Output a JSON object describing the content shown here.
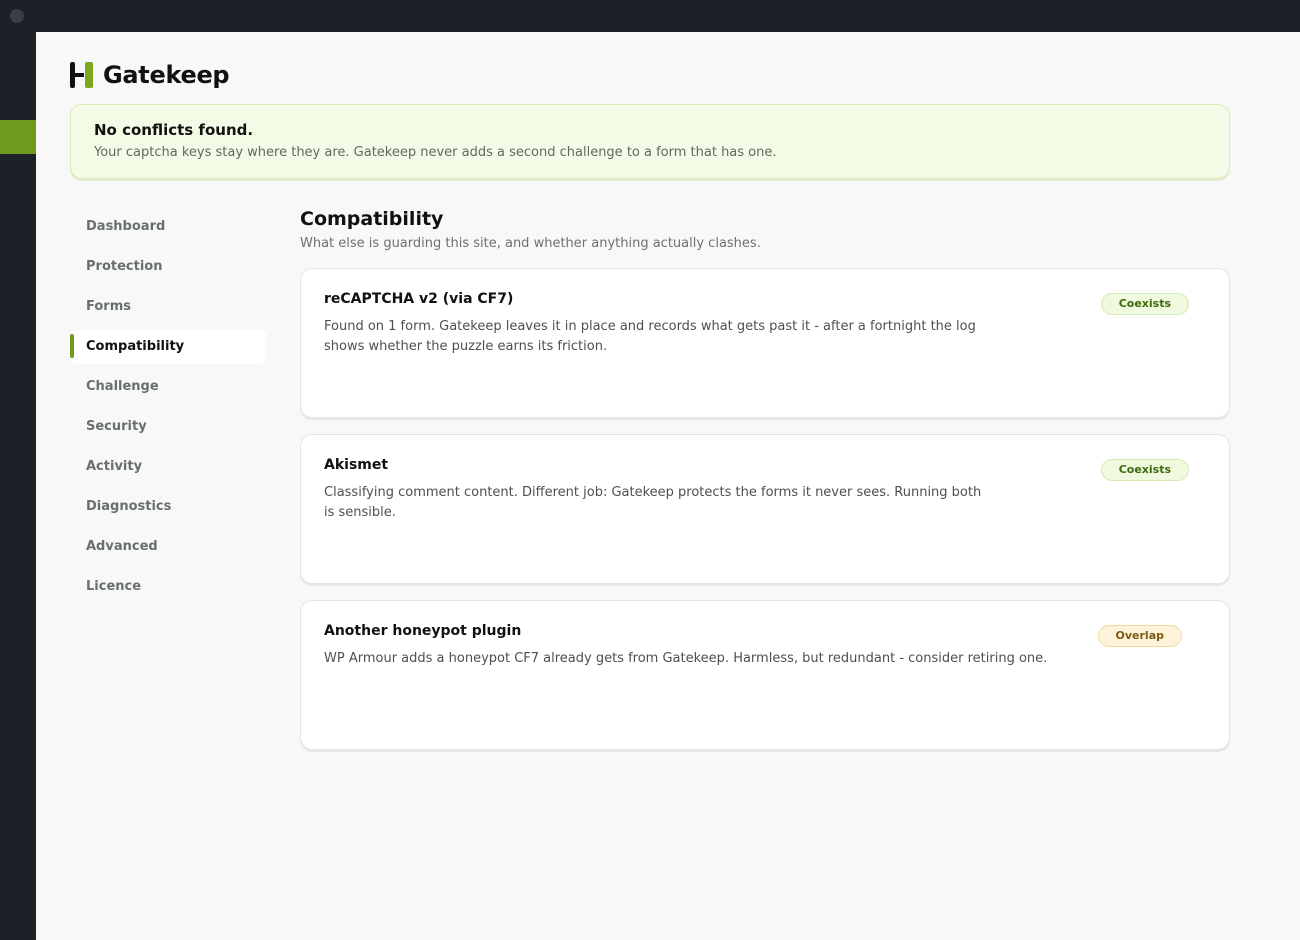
{
  "app": {
    "name": "Gatekeep"
  },
  "notice": {
    "title": "No conflicts found.",
    "body": "Your captcha keys stay where they are. Gatekeep never adds a second challenge to a form that has one."
  },
  "nav": {
    "items": [
      {
        "label": "Dashboard"
      },
      {
        "label": "Protection"
      },
      {
        "label": "Forms"
      },
      {
        "label": "Compatibility",
        "active": true
      },
      {
        "label": "Challenge"
      },
      {
        "label": "Security"
      },
      {
        "label": "Activity"
      },
      {
        "label": "Diagnostics"
      },
      {
        "label": "Advanced"
      },
      {
        "label": "Licence"
      }
    ]
  },
  "section": {
    "title": "Compatibility",
    "subtitle": "What else is guarding this site, and whether anything actually clashes."
  },
  "cards": [
    {
      "title": "reCAPTCHA v2 (via CF7)",
      "body": "Found on 1 form. Gatekeep leaves it in place and records what gets past it - after a fortnight the log shows whether the puzzle earns its friction.",
      "status": "Coexists"
    },
    {
      "title": "Akismet",
      "body": "Classifying comment content. Different job: Gatekeep protects the forms it never sees. Running both is sensible.",
      "status": "Coexists"
    },
    {
      "title": "Another honeypot plugin",
      "body": "WP Armour adds a honeypot CF7 already gets from Gatekeep. Harmless, but redundant - consider retiring one.",
      "status": "Overlap"
    }
  ],
  "colors": {
    "accent": "#6e9a1d",
    "notice_bg": "#f3fbe6",
    "coexists_text": "#3f6a0e",
    "overlap_text": "#7b5a10"
  }
}
